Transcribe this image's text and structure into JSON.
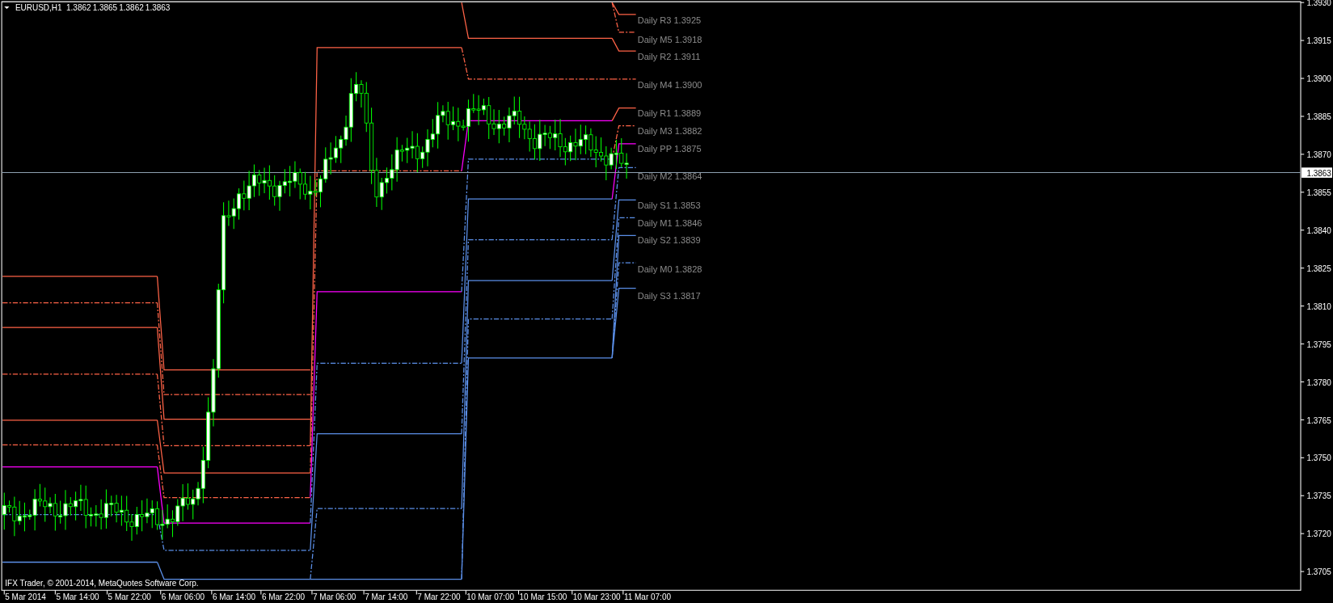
{
  "header": {
    "symbol": "EURUSD,H1",
    "ohlc": [
      "1.3862",
      "1.3865",
      "1.3862",
      "1.3863"
    ]
  },
  "price_axis": [
    "1.3930",
    "1.3915",
    "1.3900",
    "1.3885",
    "1.3870",
    "1.3855",
    "1.3840",
    "1.3825",
    "1.3810",
    "1.3795",
    "1.3780",
    "1.3765",
    "1.3750",
    "1.3735",
    "1.3720",
    "1.3705"
  ],
  "current_price": "1.3863",
  "pivot_labels": [
    "Daily R3 1.3925",
    "Daily M5 1.3918",
    "Daily R2 1.3911",
    "Daily M4 1.3900",
    "Daily R1 1.3889",
    "Daily M3 1.3882",
    "Daily PP 1.3875",
    "Daily M2 1.3864",
    "Daily S1 1.3853",
    "Daily M1 1.3846",
    "Daily S2 1.3839",
    "Daily M0 1.3828",
    "Daily S3 1.3817"
  ],
  "time_axis": [
    "5 Mar 2014",
    "5 Mar 14:00",
    "5 Mar 22:00",
    "6 Mar 06:00",
    "6 Mar 14:00",
    "6 Mar 22:00",
    "7 Mar 06:00",
    "7 Mar 14:00",
    "7 Mar 22:00",
    "10 Mar 07:00",
    "10 Mar 15:00",
    "10 Mar 23:00",
    "11 Mar 07:00"
  ],
  "copyright": "IFX Trader, © 2001-2014, MetaQuotes Software Corp."
}
